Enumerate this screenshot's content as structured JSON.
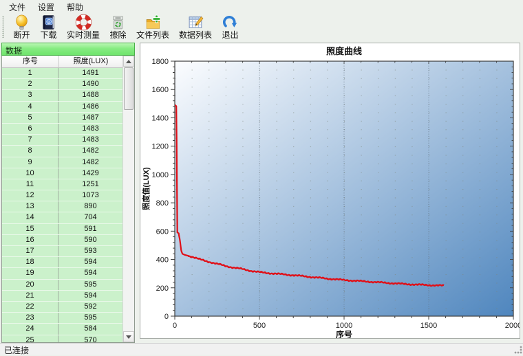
{
  "menu": {
    "items": [
      {
        "label": "文件"
      },
      {
        "label": "设置"
      },
      {
        "label": "帮助"
      }
    ]
  },
  "toolbar": {
    "buttons": [
      {
        "label": "断开",
        "icon": "bulb-icon"
      },
      {
        "label": "下载",
        "icon": "address-book-icon"
      },
      {
        "label": "实时测量",
        "icon": "lifebuoy-icon"
      },
      {
        "label": "擦除",
        "icon": "shredder-icon"
      },
      {
        "label": "文件列表",
        "icon": "folder-add-icon"
      },
      {
        "label": "数据列表",
        "icon": "data-table-icon"
      },
      {
        "label": "退出",
        "icon": "exit-arrow-icon"
      }
    ]
  },
  "sidebar": {
    "title": "数据",
    "table": {
      "headers": [
        "序号",
        "照度(LUX)"
      ],
      "rows": [
        [
          1,
          1491
        ],
        [
          2,
          1490
        ],
        [
          3,
          1488
        ],
        [
          4,
          1486
        ],
        [
          5,
          1487
        ],
        [
          6,
          1483
        ],
        [
          7,
          1483
        ],
        [
          8,
          1482
        ],
        [
          9,
          1482
        ],
        [
          10,
          1429
        ],
        [
          11,
          1251
        ],
        [
          12,
          1073
        ],
        [
          13,
          890
        ],
        [
          14,
          704
        ],
        [
          15,
          591
        ],
        [
          16,
          590
        ],
        [
          17,
          593
        ],
        [
          18,
          594
        ],
        [
          19,
          594
        ],
        [
          20,
          595
        ],
        [
          21,
          594
        ],
        [
          22,
          592
        ],
        [
          23,
          595
        ],
        [
          24,
          584
        ],
        [
          25,
          570
        ]
      ]
    }
  },
  "chart_data": {
    "type": "line",
    "title": "照度曲线",
    "xlabel": "序号",
    "ylabel": "照度值(LUX)",
    "xlim": [
      0,
      2000
    ],
    "ylim": [
      0,
      1800
    ],
    "x_ticks": [
      0,
      500,
      1000,
      1500,
      2000
    ],
    "y_ticks": [
      0,
      200,
      400,
      600,
      800,
      1000,
      1200,
      1400,
      1600,
      1800
    ],
    "x_minor_step": 100,
    "y_minor_step": 40,
    "grid": "dotted",
    "plot_bg_gradient": [
      "#fcfdff",
      "#4f86be"
    ],
    "series": [
      {
        "name": "照度",
        "color": "#e01018",
        "points": [
          [
            1,
            1491
          ],
          [
            9,
            1482
          ],
          [
            10,
            1429
          ],
          [
            11,
            1251
          ],
          [
            12,
            1073
          ],
          [
            13,
            890
          ],
          [
            14,
            704
          ],
          [
            15,
            591
          ],
          [
            24,
            584
          ],
          [
            25,
            570
          ],
          [
            30,
            540
          ],
          [
            38,
            462
          ],
          [
            45,
            440
          ],
          [
            60,
            432
          ],
          [
            100,
            420
          ],
          [
            150,
            400
          ],
          [
            200,
            384
          ],
          [
            250,
            369
          ],
          [
            300,
            354
          ],
          [
            350,
            342
          ],
          [
            400,
            332
          ],
          [
            450,
            320
          ],
          [
            500,
            310
          ],
          [
            600,
            299
          ],
          [
            700,
            289
          ],
          [
            800,
            277
          ],
          [
            900,
            265
          ],
          [
            1000,
            255
          ],
          [
            1100,
            247
          ],
          [
            1200,
            239
          ],
          [
            1300,
            231
          ],
          [
            1400,
            224
          ],
          [
            1500,
            219
          ],
          [
            1590,
            215
          ]
        ]
      }
    ]
  },
  "statusbar": {
    "text": "已连接"
  }
}
